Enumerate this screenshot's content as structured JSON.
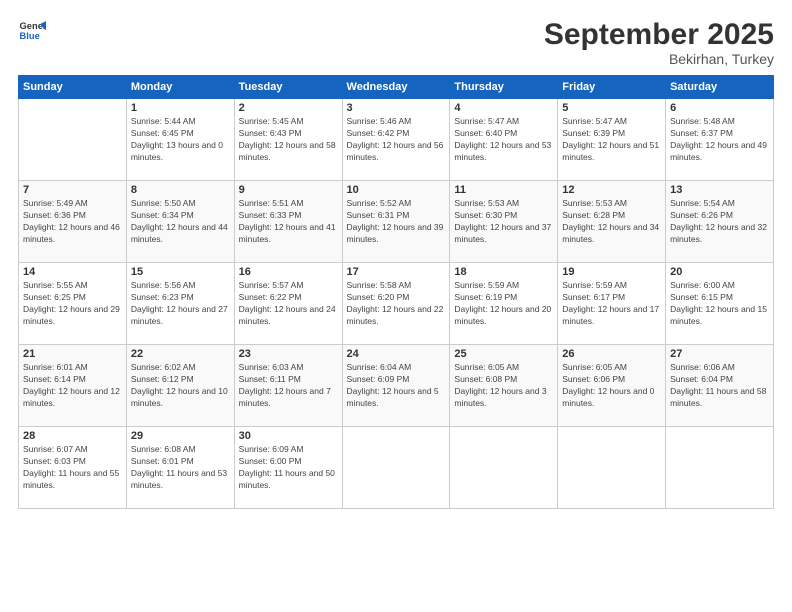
{
  "logo": {
    "line1": "General",
    "line2": "Blue"
  },
  "title": "September 2025",
  "subtitle": "Bekirhan, Turkey",
  "days_header": [
    "Sunday",
    "Monday",
    "Tuesday",
    "Wednesday",
    "Thursday",
    "Friday",
    "Saturday"
  ],
  "weeks": [
    [
      {
        "day": "",
        "sunrise": "",
        "sunset": "",
        "daylight": ""
      },
      {
        "day": "1",
        "sunrise": "Sunrise: 5:44 AM",
        "sunset": "Sunset: 6:45 PM",
        "daylight": "Daylight: 13 hours and 0 minutes."
      },
      {
        "day": "2",
        "sunrise": "Sunrise: 5:45 AM",
        "sunset": "Sunset: 6:43 PM",
        "daylight": "Daylight: 12 hours and 58 minutes."
      },
      {
        "day": "3",
        "sunrise": "Sunrise: 5:46 AM",
        "sunset": "Sunset: 6:42 PM",
        "daylight": "Daylight: 12 hours and 56 minutes."
      },
      {
        "day": "4",
        "sunrise": "Sunrise: 5:47 AM",
        "sunset": "Sunset: 6:40 PM",
        "daylight": "Daylight: 12 hours and 53 minutes."
      },
      {
        "day": "5",
        "sunrise": "Sunrise: 5:47 AM",
        "sunset": "Sunset: 6:39 PM",
        "daylight": "Daylight: 12 hours and 51 minutes."
      },
      {
        "day": "6",
        "sunrise": "Sunrise: 5:48 AM",
        "sunset": "Sunset: 6:37 PM",
        "daylight": "Daylight: 12 hours and 49 minutes."
      }
    ],
    [
      {
        "day": "7",
        "sunrise": "Sunrise: 5:49 AM",
        "sunset": "Sunset: 6:36 PM",
        "daylight": "Daylight: 12 hours and 46 minutes."
      },
      {
        "day": "8",
        "sunrise": "Sunrise: 5:50 AM",
        "sunset": "Sunset: 6:34 PM",
        "daylight": "Daylight: 12 hours and 44 minutes."
      },
      {
        "day": "9",
        "sunrise": "Sunrise: 5:51 AM",
        "sunset": "Sunset: 6:33 PM",
        "daylight": "Daylight: 12 hours and 41 minutes."
      },
      {
        "day": "10",
        "sunrise": "Sunrise: 5:52 AM",
        "sunset": "Sunset: 6:31 PM",
        "daylight": "Daylight: 12 hours and 39 minutes."
      },
      {
        "day": "11",
        "sunrise": "Sunrise: 5:53 AM",
        "sunset": "Sunset: 6:30 PM",
        "daylight": "Daylight: 12 hours and 37 minutes."
      },
      {
        "day": "12",
        "sunrise": "Sunrise: 5:53 AM",
        "sunset": "Sunset: 6:28 PM",
        "daylight": "Daylight: 12 hours and 34 minutes."
      },
      {
        "day": "13",
        "sunrise": "Sunrise: 5:54 AM",
        "sunset": "Sunset: 6:26 PM",
        "daylight": "Daylight: 12 hours and 32 minutes."
      }
    ],
    [
      {
        "day": "14",
        "sunrise": "Sunrise: 5:55 AM",
        "sunset": "Sunset: 6:25 PM",
        "daylight": "Daylight: 12 hours and 29 minutes."
      },
      {
        "day": "15",
        "sunrise": "Sunrise: 5:56 AM",
        "sunset": "Sunset: 6:23 PM",
        "daylight": "Daylight: 12 hours and 27 minutes."
      },
      {
        "day": "16",
        "sunrise": "Sunrise: 5:57 AM",
        "sunset": "Sunset: 6:22 PM",
        "daylight": "Daylight: 12 hours and 24 minutes."
      },
      {
        "day": "17",
        "sunrise": "Sunrise: 5:58 AM",
        "sunset": "Sunset: 6:20 PM",
        "daylight": "Daylight: 12 hours and 22 minutes."
      },
      {
        "day": "18",
        "sunrise": "Sunrise: 5:59 AM",
        "sunset": "Sunset: 6:19 PM",
        "daylight": "Daylight: 12 hours and 20 minutes."
      },
      {
        "day": "19",
        "sunrise": "Sunrise: 5:59 AM",
        "sunset": "Sunset: 6:17 PM",
        "daylight": "Daylight: 12 hours and 17 minutes."
      },
      {
        "day": "20",
        "sunrise": "Sunrise: 6:00 AM",
        "sunset": "Sunset: 6:15 PM",
        "daylight": "Daylight: 12 hours and 15 minutes."
      }
    ],
    [
      {
        "day": "21",
        "sunrise": "Sunrise: 6:01 AM",
        "sunset": "Sunset: 6:14 PM",
        "daylight": "Daylight: 12 hours and 12 minutes."
      },
      {
        "day": "22",
        "sunrise": "Sunrise: 6:02 AM",
        "sunset": "Sunset: 6:12 PM",
        "daylight": "Daylight: 12 hours and 10 minutes."
      },
      {
        "day": "23",
        "sunrise": "Sunrise: 6:03 AM",
        "sunset": "Sunset: 6:11 PM",
        "daylight": "Daylight: 12 hours and 7 minutes."
      },
      {
        "day": "24",
        "sunrise": "Sunrise: 6:04 AM",
        "sunset": "Sunset: 6:09 PM",
        "daylight": "Daylight: 12 hours and 5 minutes."
      },
      {
        "day": "25",
        "sunrise": "Sunrise: 6:05 AM",
        "sunset": "Sunset: 6:08 PM",
        "daylight": "Daylight: 12 hours and 3 minutes."
      },
      {
        "day": "26",
        "sunrise": "Sunrise: 6:05 AM",
        "sunset": "Sunset: 6:06 PM",
        "daylight": "Daylight: 12 hours and 0 minutes."
      },
      {
        "day": "27",
        "sunrise": "Sunrise: 6:06 AM",
        "sunset": "Sunset: 6:04 PM",
        "daylight": "Daylight: 11 hours and 58 minutes."
      }
    ],
    [
      {
        "day": "28",
        "sunrise": "Sunrise: 6:07 AM",
        "sunset": "Sunset: 6:03 PM",
        "daylight": "Daylight: 11 hours and 55 minutes."
      },
      {
        "day": "29",
        "sunrise": "Sunrise: 6:08 AM",
        "sunset": "Sunset: 6:01 PM",
        "daylight": "Daylight: 11 hours and 53 minutes."
      },
      {
        "day": "30",
        "sunrise": "Sunrise: 6:09 AM",
        "sunset": "Sunset: 6:00 PM",
        "daylight": "Daylight: 11 hours and 50 minutes."
      },
      {
        "day": "",
        "sunrise": "",
        "sunset": "",
        "daylight": ""
      },
      {
        "day": "",
        "sunrise": "",
        "sunset": "",
        "daylight": ""
      },
      {
        "day": "",
        "sunrise": "",
        "sunset": "",
        "daylight": ""
      },
      {
        "day": "",
        "sunrise": "",
        "sunset": "",
        "daylight": ""
      }
    ]
  ]
}
